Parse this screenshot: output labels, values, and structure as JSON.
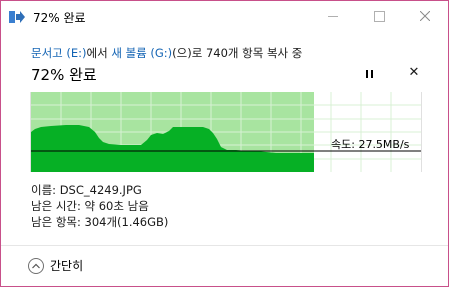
{
  "window": {
    "title": "72% 완료",
    "controls": [
      "minimize",
      "maximize",
      "close"
    ]
  },
  "copy": {
    "source_name": "문서고 (E:)",
    "from_text": "에서 ",
    "dest_name": "새 볼륨 (G:)",
    "rest_text": "(으)로 740개 항목 복사 중"
  },
  "progress": {
    "title": "72% 완료",
    "percent": 72,
    "pause_icon": "pause-icon",
    "cancel_icon": "close-icon",
    "cancel_glyph": "✕"
  },
  "graph": {
    "speed_label": "속도: 27.5MB/s",
    "fill_color": "#a8e4a0",
    "area_color": "#06b025",
    "speed_line_color": "#000000"
  },
  "details": {
    "name_label": "이름: DSC_4249.JPG",
    "time_label": "남은 시간: 약 60초 남음",
    "items_label": "남은 항목: 304개(1.46GB)"
  },
  "footer": {
    "collapse_label": "간단히"
  }
}
